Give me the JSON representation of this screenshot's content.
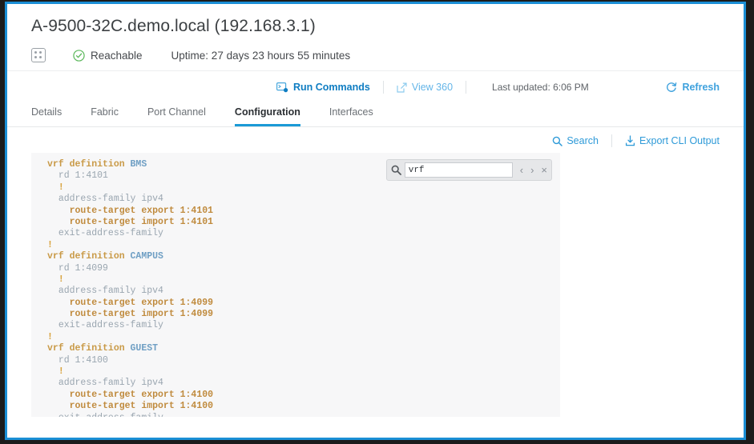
{
  "header": {
    "device_title": "A-9500-32C.demo.local (192.168.3.1)",
    "chassis_icon": "chassis-icon",
    "status_icon": "check-circle-icon",
    "status_label": "Reachable",
    "uptime": "Uptime: 27 days 23 hours 55 minutes",
    "status_color": "#5cb85c"
  },
  "action_bar": {
    "run_commands": {
      "icon": "terminal-icon",
      "label": "Run Commands"
    },
    "view_360": {
      "icon": "external-link-icon",
      "label": "View 360"
    },
    "last_updated": "Last updated: 6:06 PM",
    "refresh": {
      "icon": "refresh-icon",
      "label": "Refresh"
    }
  },
  "tabs": [
    {
      "label": "Details",
      "active": false
    },
    {
      "label": "Fabric",
      "active": false
    },
    {
      "label": "Port Channel",
      "active": false
    },
    {
      "label": "Configuration",
      "active": true
    },
    {
      "label": "Interfaces",
      "active": false
    }
  ],
  "cli_toolbar": {
    "search": {
      "icon": "search-icon",
      "label": "Search"
    },
    "export": {
      "icon": "export-icon",
      "label": "Export CLI Output"
    }
  },
  "find_widget": {
    "icon": "search-icon",
    "value": "vrf",
    "placeholder": "",
    "prev_label": "‹",
    "next_label": "›",
    "close_label": "×"
  },
  "cli_output": {
    "lines": [
      {
        "indent": 0,
        "parts": [
          {
            "text": "vrf definition ",
            "style": "key"
          },
          {
            "text": "BMS",
            "style": "name"
          }
        ]
      },
      {
        "indent": 1,
        "parts": [
          {
            "text": "rd 1:4101",
            "style": "plain"
          }
        ]
      },
      {
        "indent": 1,
        "parts": [
          {
            "text": "!",
            "style": "bang"
          }
        ]
      },
      {
        "indent": 1,
        "parts": [
          {
            "text": "address-family ipv4",
            "style": "plain"
          }
        ]
      },
      {
        "indent": 2,
        "parts": [
          {
            "text": "route-target export 1:4101",
            "style": "rt"
          }
        ]
      },
      {
        "indent": 2,
        "parts": [
          {
            "text": "route-target import 1:4101",
            "style": "rt"
          }
        ]
      },
      {
        "indent": 1,
        "parts": [
          {
            "text": "exit-address-family",
            "style": "plain"
          }
        ]
      },
      {
        "indent": 0,
        "parts": [
          {
            "text": "!",
            "style": "bang"
          }
        ]
      },
      {
        "indent": 0,
        "parts": [
          {
            "text": "vrf definition ",
            "style": "key"
          },
          {
            "text": "CAMPUS",
            "style": "name"
          }
        ]
      },
      {
        "indent": 1,
        "parts": [
          {
            "text": "rd 1:4099",
            "style": "plain"
          }
        ]
      },
      {
        "indent": 1,
        "parts": [
          {
            "text": "!",
            "style": "bang"
          }
        ]
      },
      {
        "indent": 1,
        "parts": [
          {
            "text": "address-family ipv4",
            "style": "plain"
          }
        ]
      },
      {
        "indent": 2,
        "parts": [
          {
            "text": "route-target export 1:4099",
            "style": "rt"
          }
        ]
      },
      {
        "indent": 2,
        "parts": [
          {
            "text": "route-target import 1:4099",
            "style": "rt"
          }
        ]
      },
      {
        "indent": 1,
        "parts": [
          {
            "text": "exit-address-family",
            "style": "plain"
          }
        ]
      },
      {
        "indent": 0,
        "parts": [
          {
            "text": "!",
            "style": "bang"
          }
        ]
      },
      {
        "indent": 0,
        "parts": [
          {
            "text": "vrf definition ",
            "style": "key"
          },
          {
            "text": "GUEST",
            "style": "name"
          }
        ]
      },
      {
        "indent": 1,
        "parts": [
          {
            "text": "rd 1:4100",
            "style": "plain"
          }
        ]
      },
      {
        "indent": 1,
        "parts": [
          {
            "text": "!",
            "style": "bang"
          }
        ]
      },
      {
        "indent": 1,
        "parts": [
          {
            "text": "address-family ipv4",
            "style": "plain"
          }
        ]
      },
      {
        "indent": 2,
        "parts": [
          {
            "text": "route-target export 1:4100",
            "style": "rt"
          }
        ]
      },
      {
        "indent": 2,
        "parts": [
          {
            "text": "route-target import 1:4100",
            "style": "rt"
          }
        ]
      },
      {
        "indent": 1,
        "parts": [
          {
            "text": "exit-address-family",
            "style": "plain"
          }
        ]
      },
      {
        "indent": 0,
        "parts": [
          {
            "text": "!",
            "style": "bang"
          }
        ]
      }
    ]
  },
  "theme": {
    "accent": "#1b8fd6",
    "link": "#2e9ad8",
    "tab_active_underline": "#1b9ad6",
    "code_bg": "#f7f7f8"
  }
}
